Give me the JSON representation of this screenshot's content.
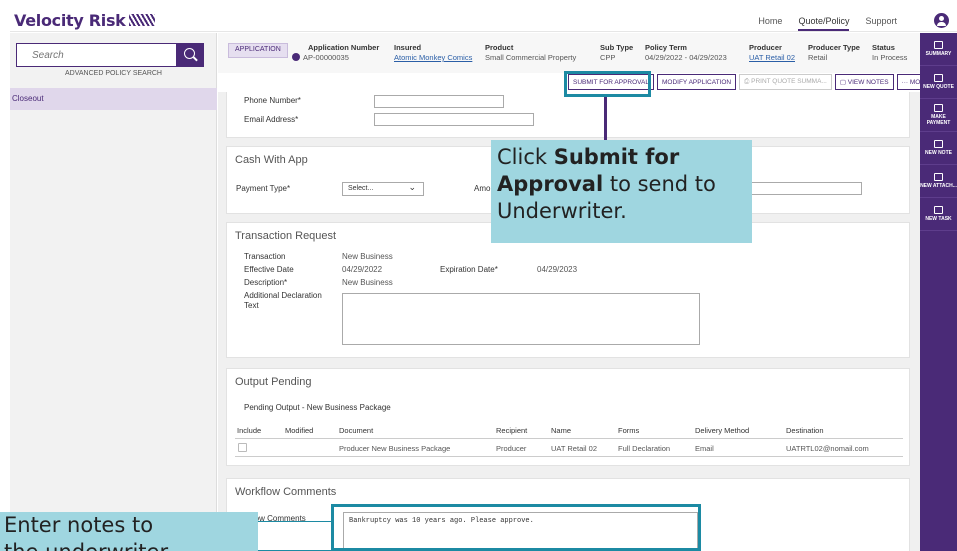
{
  "brand": {
    "name": "Velocity Risk"
  },
  "topnav": {
    "home": "Home",
    "quote_policy": "Quote/Policy",
    "support": "Support"
  },
  "sidebar": {
    "search_placeholder": "Search",
    "advanced_search": "ADVANCED POLICY SEARCH",
    "items": [
      {
        "label": "Closeout"
      }
    ]
  },
  "header": {
    "badge": "APPLICATION",
    "columns": [
      {
        "heading": "Application Number",
        "value": "AP-00000035"
      },
      {
        "heading": "Insured",
        "value": "Atomic Monkey Comics"
      },
      {
        "heading": "Product",
        "value": "Small Commercial Property"
      },
      {
        "heading": "Sub Type",
        "value": "CPP"
      },
      {
        "heading": "Policy Term",
        "value": "04/29/2022 - 04/29/2023"
      },
      {
        "heading": "Producer",
        "value": "UAT Retail 02"
      },
      {
        "heading": "Producer Type",
        "value": "Retail"
      },
      {
        "heading": "Status",
        "value": "In Process"
      }
    ]
  },
  "actions": {
    "submit": "SUBMIT FOR APPROVAL",
    "modify": "MODIFY APPLICATION",
    "print": "PRINT QUOTE SUMMA...",
    "notes": "VIEW NOTES",
    "more": "··· MORE"
  },
  "rightbar": {
    "items": [
      {
        "label": "SUMMARY",
        "icon": "summary-icon"
      },
      {
        "label": "NEW QUOTE",
        "icon": "document-icon"
      },
      {
        "label": "MAKE PAYMENT",
        "icon": "payment-icon"
      },
      {
        "label": "NEW NOTE",
        "icon": "note-icon"
      },
      {
        "label": "NEW ATTACH...",
        "icon": "paperclip-icon"
      },
      {
        "label": "NEW TASK",
        "icon": "task-icon"
      }
    ]
  },
  "contact": {
    "phone_label": "Phone Number*",
    "email_label": "Email Address*"
  },
  "cash_with_app": {
    "title": "Cash With App",
    "payment_type_label": "Payment Type*",
    "payment_type_value": "Select...",
    "amount_label_visible": "Amo"
  },
  "transaction": {
    "title": "Transaction Request",
    "transaction_label": "Transaction",
    "transaction_value": "New Business",
    "effective_label": "Effective Date",
    "effective_value": "04/29/2022",
    "expiration_label": "Expiration Date*",
    "expiration_value": "04/29/2023",
    "description_label": "Description*",
    "description_value": "New Business",
    "additional_label": "Additional Declaration Text"
  },
  "output_pending": {
    "title": "Output Pending",
    "subtitle": "Pending Output - New Business Package",
    "columns": [
      "Include",
      "Modified",
      "Document",
      "Recipient",
      "Name",
      "Forms",
      "Delivery Method",
      "Destination"
    ],
    "rows": [
      {
        "document": "Producer New Business Package",
        "recipient": "Producer",
        "name": "UAT Retail 02",
        "forms": "Full Declaration",
        "delivery": "Email",
        "destination": "UATRTL02@nomail.com"
      }
    ]
  },
  "workflow": {
    "title": "Workflow Comments",
    "label_visible": "rkflow Comments",
    "value": "Bankruptcy was 10 years ago.  Please approve."
  },
  "callouts": {
    "submit_pre": "Click ",
    "submit_bold": "Submit for Approval",
    "submit_post": " to send to Underwriter.",
    "notes_line1": "Enter notes to",
    "notes_line2": "the underwriter"
  }
}
